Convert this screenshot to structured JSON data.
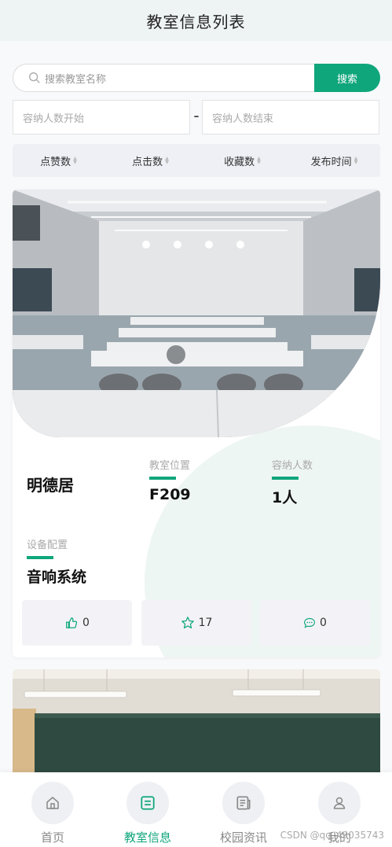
{
  "header": {
    "title": "教室信息列表"
  },
  "search": {
    "placeholder": "搜索教室名称",
    "button": "搜索"
  },
  "capacity_filter": {
    "start_placeholder": "容纳人数开始",
    "separator": "-",
    "end_placeholder": "容纳人数结束"
  },
  "sort_bar": {
    "items": [
      "点赞数",
      "点击数",
      "收藏数",
      "发布时间"
    ]
  },
  "card": {
    "name": "明德居",
    "location_label": "教室位置",
    "location_value": "F209",
    "capacity_label": "容纳人数",
    "capacity_value": "1人",
    "equipment_label": "设备配置",
    "equipment_value": "音响系统",
    "likes": "0",
    "favorites": "17",
    "comments": "0"
  },
  "tabbar": {
    "items": [
      {
        "label": "首页",
        "icon": "home-icon"
      },
      {
        "label": "教室信息",
        "icon": "doc-icon"
      },
      {
        "label": "校园资讯",
        "icon": "news-icon"
      },
      {
        "label": "我的",
        "icon": "user-icon"
      }
    ],
    "active_index": 1
  },
  "watermark": "CSDN @qq_49035743",
  "colors": {
    "accent": "#0fa67c",
    "header_bg": "#eef3f3",
    "sort_bg": "#eff0f5"
  }
}
